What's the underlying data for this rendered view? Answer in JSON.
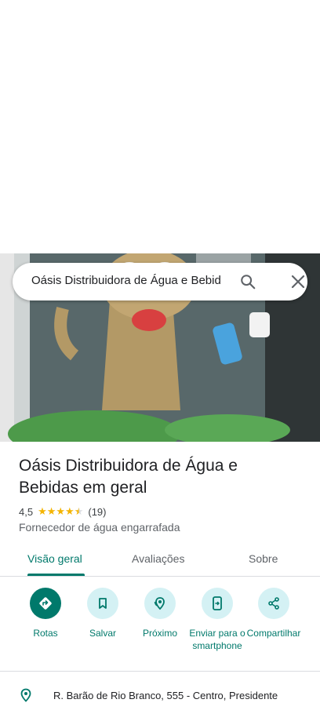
{
  "search": {
    "query": "Oásis Distribuidora de Água e Bebid"
  },
  "place": {
    "name": "Oásis Distribuidora de Água e Bebidas em geral",
    "rating": "4,5",
    "rating_value": 4.5,
    "review_count": "(19)",
    "category": "Fornecedor de água engarrafada"
  },
  "tabs": [
    {
      "label": "Visão geral",
      "active": true
    },
    {
      "label": "Avaliações",
      "active": false
    },
    {
      "label": "Sobre",
      "active": false
    }
  ],
  "actions": [
    {
      "label": "Rotas",
      "icon": "directions-icon"
    },
    {
      "label": "Salvar",
      "icon": "bookmark-icon"
    },
    {
      "label": "Próximo",
      "icon": "nearby-icon"
    },
    {
      "label": "Enviar para o smartphone",
      "icon": "send-to-phone-icon"
    },
    {
      "label": "Compartilhar",
      "icon": "share-icon"
    }
  ],
  "address": {
    "text": "R. Barão de Rio Branco, 555 - Centro, Presidente"
  },
  "colors": {
    "accent": "#00796b",
    "chip": "#d4f1f4",
    "star": "#f4b400"
  }
}
